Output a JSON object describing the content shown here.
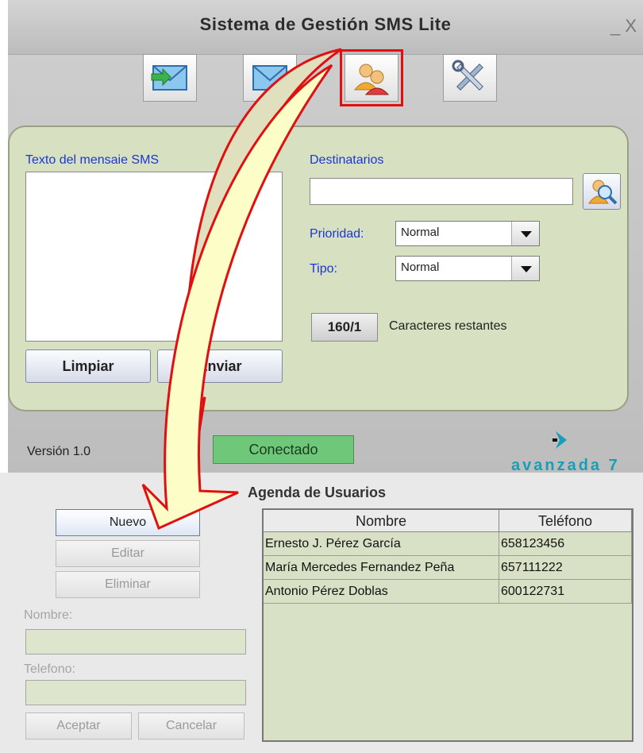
{
  "window": {
    "title": "Sistema de Gestión SMS Lite",
    "controls": "_ X"
  },
  "toolbar": {
    "buttons": [
      {
        "name": "inbox-icon"
      },
      {
        "name": "compose-icon"
      },
      {
        "name": "contacts-icon",
        "selected": true
      },
      {
        "name": "tools-icon"
      }
    ]
  },
  "compose": {
    "message_label": "Texto del mensaie SMS",
    "recipients_label": "Destinatarios",
    "recipients_value": "",
    "priority_label": "Prioridad:",
    "priority_value": "Normal",
    "type_label": "Tipo:",
    "type_value": "Normal",
    "counter_value": "160/1",
    "counter_label": "Caracteres restantes",
    "clear_label": "Limpiar",
    "send_label": "Enviar"
  },
  "status": {
    "version": "Versión 1.0",
    "connection": "Conectado",
    "brand": "avanzada 7"
  },
  "agenda": {
    "title": "Agenda de Usuarios",
    "new_label": "Nuevo",
    "edit_label": "Editar",
    "delete_label": "Eliminar",
    "name_label": "Nombre:",
    "phone_label": "Telefono:",
    "accept_label": "Aceptar",
    "cancel_label": "Cancelar",
    "columns": [
      "Nombre",
      "Teléfono"
    ],
    "rows": [
      {
        "name": "Ernesto J. Pérez García",
        "phone": "658123456"
      },
      {
        "name": "María Mercedes Fernandez Peña",
        "phone": "657111222"
      },
      {
        "name": "Antonio Pérez Doblas",
        "phone": "600122731"
      }
    ]
  },
  "colors": {
    "panel": "#d7e0c1",
    "accent_red": "#e01010",
    "connected": "#6fc77a",
    "label_blue": "#1c36d8"
  }
}
